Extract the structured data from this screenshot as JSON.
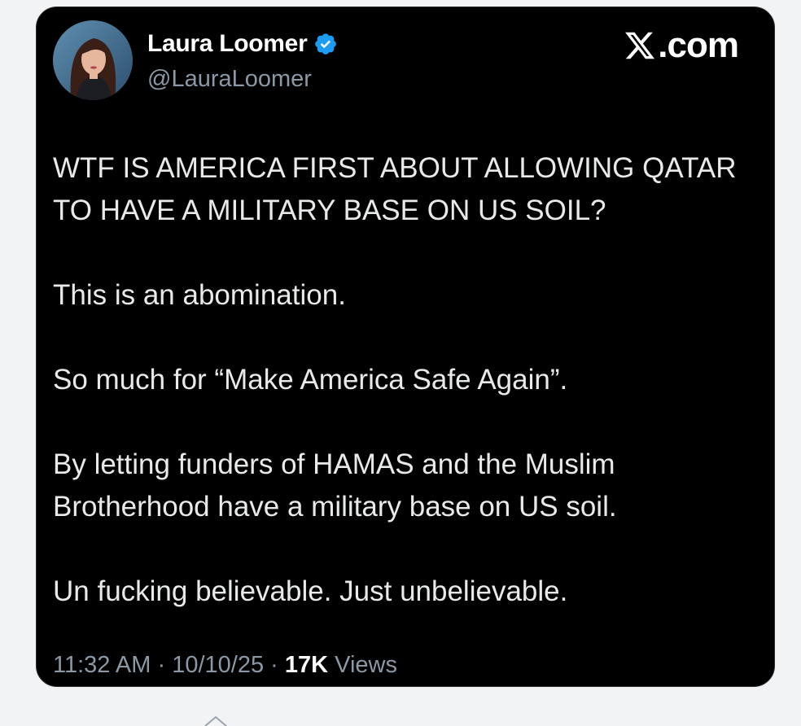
{
  "author": {
    "display_name": "Laura Loomer",
    "handle": "@LauraLoomer",
    "verified": true,
    "verified_color": "#1d9bf0"
  },
  "brand": {
    "label": ".com",
    "icon": "x-logo-icon"
  },
  "tweet": {
    "paragraphs": [
      "WTF IS AMERICA FIRST ABOUT ALLOWING QATAR TO HAVE A MILITARY BASE ON US SOIL?",
      "This is an abomination.",
      "So much for “Make America Safe Again”.",
      "By letting funders of HAMAS and the Muslim Brotherhood have a military base on US soil.",
      "Un fucking believable. Just unbelievable."
    ]
  },
  "meta": {
    "time": "11:32 AM",
    "date": "10/10/25",
    "views_count": "17K",
    "views_label": "Views",
    "separator": "·"
  },
  "colors": {
    "card_background": "#000000",
    "page_background": "#f2f3f5",
    "muted_text": "#8b98a5"
  }
}
